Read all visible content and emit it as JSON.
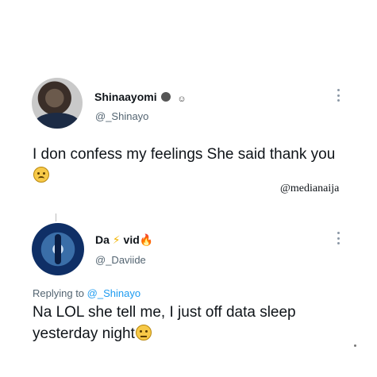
{
  "tweet1": {
    "display_name": "Shinaayomi",
    "handle": "@_Shinayo",
    "text": "I don confess my feelings She said thank you",
    "emoji_name": "worried-face-icon"
  },
  "watermark": "@medianaija",
  "tweet2": {
    "display_name_left": "Da",
    "display_name_right": "vid",
    "handle": "@_Daviide",
    "reply_label": "Replying to",
    "reply_to": "@_Shinayo",
    "text": "Na LOL she tell me, I just off data sleep yesterday night",
    "emoji_name": "sleepy-face-icon"
  }
}
